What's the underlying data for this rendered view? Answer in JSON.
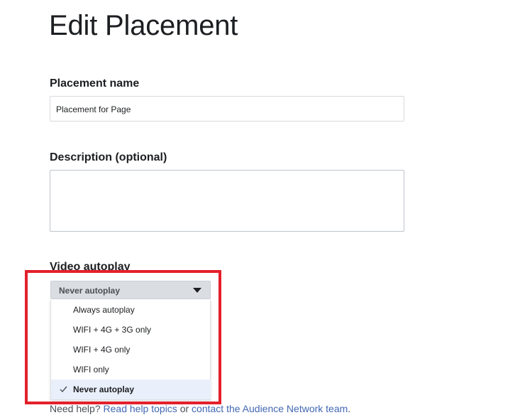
{
  "page": {
    "title": "Edit Placement"
  },
  "form": {
    "placement_name_label": "Placement name",
    "placement_name_value": "Placement for Page",
    "description_label": "Description (optional)",
    "description_value": "",
    "video_autoplay_label": "Video autoplay",
    "video_autoplay_selected": "Never autoplay",
    "video_autoplay_options": [
      {
        "label": "Always autoplay",
        "selected": false
      },
      {
        "label": "WIFI + 4G + 3G only",
        "selected": false
      },
      {
        "label": "WIFI + 4G only",
        "selected": false
      },
      {
        "label": "WIFI only",
        "selected": false
      },
      {
        "label": "Never autoplay",
        "selected": true
      }
    ]
  },
  "help": {
    "prefix": "Need help?",
    "link1": "Read help topics",
    "middle": "or",
    "link2": "contact the Audience Network team",
    "suffix": "."
  },
  "colors": {
    "highlight": "#e3202b",
    "link": "#4267b2",
    "selected_bg": "#eaf0fb"
  },
  "icons": {
    "dropdown": "chevron-down-icon",
    "selected": "checkmark-icon"
  }
}
